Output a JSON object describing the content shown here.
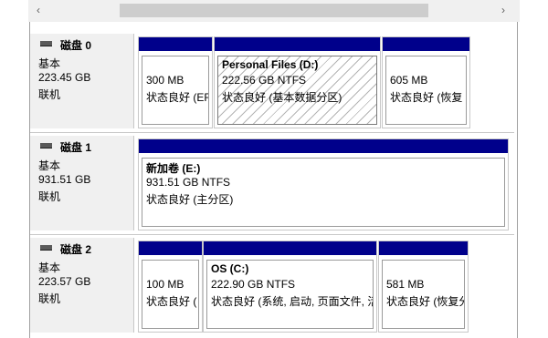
{
  "scroll": {
    "left_arrow": "‹",
    "right_arrow": "›"
  },
  "disks": [
    {
      "name": "磁盘 0",
      "type": "基本",
      "size": "223.45 GB",
      "status": "联机",
      "partitions": [
        {
          "title": "",
          "size": "300 MB",
          "status": "状态良好 (EF"
        },
        {
          "title": "Personal Files  (D:)",
          "size": "222.56 GB NTFS",
          "status": "状态良好 (基本数据分区)"
        },
        {
          "title": "",
          "size": "605 MB",
          "status": "状态良好 (恢复"
        }
      ]
    },
    {
      "name": "磁盘 1",
      "type": "基本",
      "size": "931.51 GB",
      "status": "联机",
      "partitions": [
        {
          "title": "新加卷  (E:)",
          "size": "931.51 GB NTFS",
          "status": "状态良好 (主分区)"
        }
      ]
    },
    {
      "name": "磁盘 2",
      "type": "基本",
      "size": "223.57 GB",
      "status": "联机",
      "partitions": [
        {
          "title": "",
          "size": "100 MB",
          "status": "状态良好 ("
        },
        {
          "title": "OS  (C:)",
          "size": "222.90 GB NTFS",
          "status": "状态良好 (系统, 启动, 页面文件, 活"
        },
        {
          "title": "",
          "size": "581 MB",
          "status": "状态良好 (恢复分"
        }
      ]
    }
  ]
}
